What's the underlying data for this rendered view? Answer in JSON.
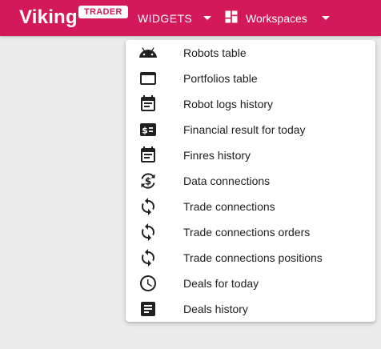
{
  "header": {
    "brand": "Viking",
    "badge": "TRADER",
    "widgets_label": "WIDGETS",
    "workspaces_label": "Workspaces",
    "icons": {
      "widgets_caret": "caret-down-icon",
      "workspaces": "dashboard-icon",
      "workspaces_caret": "caret-down-icon"
    }
  },
  "menu": {
    "items": [
      {
        "label": "Robots table",
        "icon": "android-robot-icon"
      },
      {
        "label": "Portfolios table",
        "icon": "window-icon"
      },
      {
        "label": "Robot logs history",
        "icon": "calendar-icon"
      },
      {
        "label": "Financial result for today",
        "icon": "money-sign-icon"
      },
      {
        "label": "Finres history",
        "icon": "calendar-icon"
      },
      {
        "label": "Data connections",
        "icon": "currency-exchange-icon"
      },
      {
        "label": "Trade connections",
        "icon": "sync-icon"
      },
      {
        "label": "Trade connections orders",
        "icon": "sync-icon"
      },
      {
        "label": "Trade connections positions",
        "icon": "sync-icon"
      },
      {
        "label": "Deals for today",
        "icon": "clock-icon"
      },
      {
        "label": "Deals history",
        "icon": "notes-icon"
      }
    ]
  },
  "colors": {
    "topbar": "#d3195a",
    "background": "#ebebeb",
    "menu_text": "#212121",
    "icon": "#212121"
  }
}
